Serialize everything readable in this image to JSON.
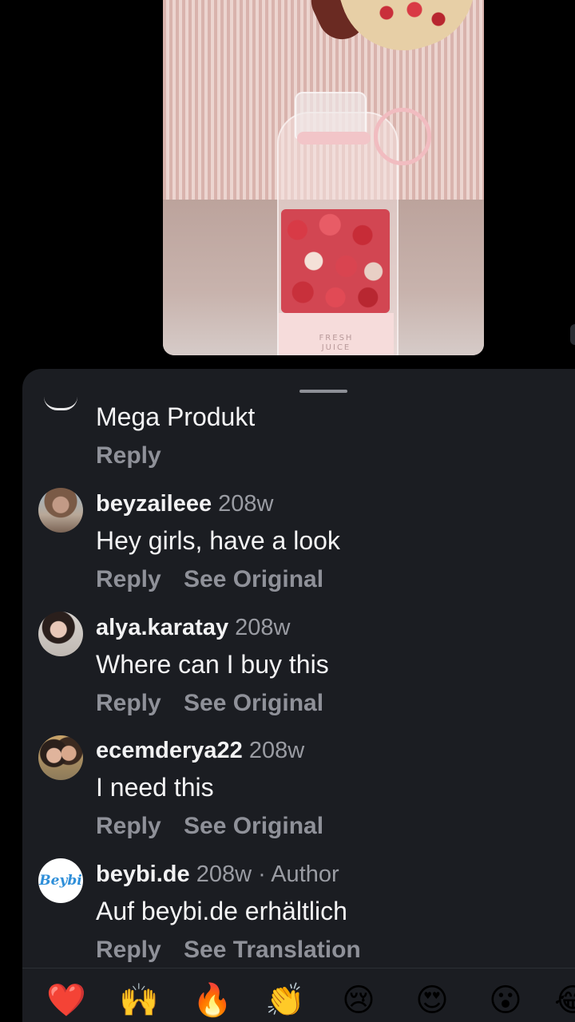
{
  "video": {
    "label_line1": "FRESH",
    "label_line2": "JUICE"
  },
  "comments": {
    "partial": {
      "text": "Mega Produkt",
      "reply_label": "Reply"
    },
    "items": [
      {
        "username": "beyzaileee",
        "meta": "208w",
        "text": "Hey girls, have a look",
        "reply_label": "Reply",
        "secondary_label": "See Original"
      },
      {
        "username": "alya.karatay",
        "meta": "208w",
        "text": "Where can I buy this",
        "reply_label": "Reply",
        "secondary_label": "See Original"
      },
      {
        "username": "ecemderya22",
        "meta": "208w",
        "text": "I need this",
        "reply_label": "Reply",
        "secondary_label": "See Original"
      },
      {
        "username": "beybi.de",
        "meta": "208w · Author",
        "avatar_logo_text": "Beybi",
        "text": "Auf beybi.de erhältlich",
        "reply_label": "Reply",
        "secondary_label": "See Translation"
      }
    ]
  },
  "emoji_bar": [
    "❤️",
    "🙌",
    "🔥",
    "👏",
    "😢",
    "😍",
    "😮",
    "😂"
  ],
  "colors": {
    "background": "#000000",
    "sheet": "#1b1d22",
    "primary_text": "#f4f4f5",
    "secondary_text": "#8f9199",
    "logo_blue": "#2f8fd9"
  }
}
